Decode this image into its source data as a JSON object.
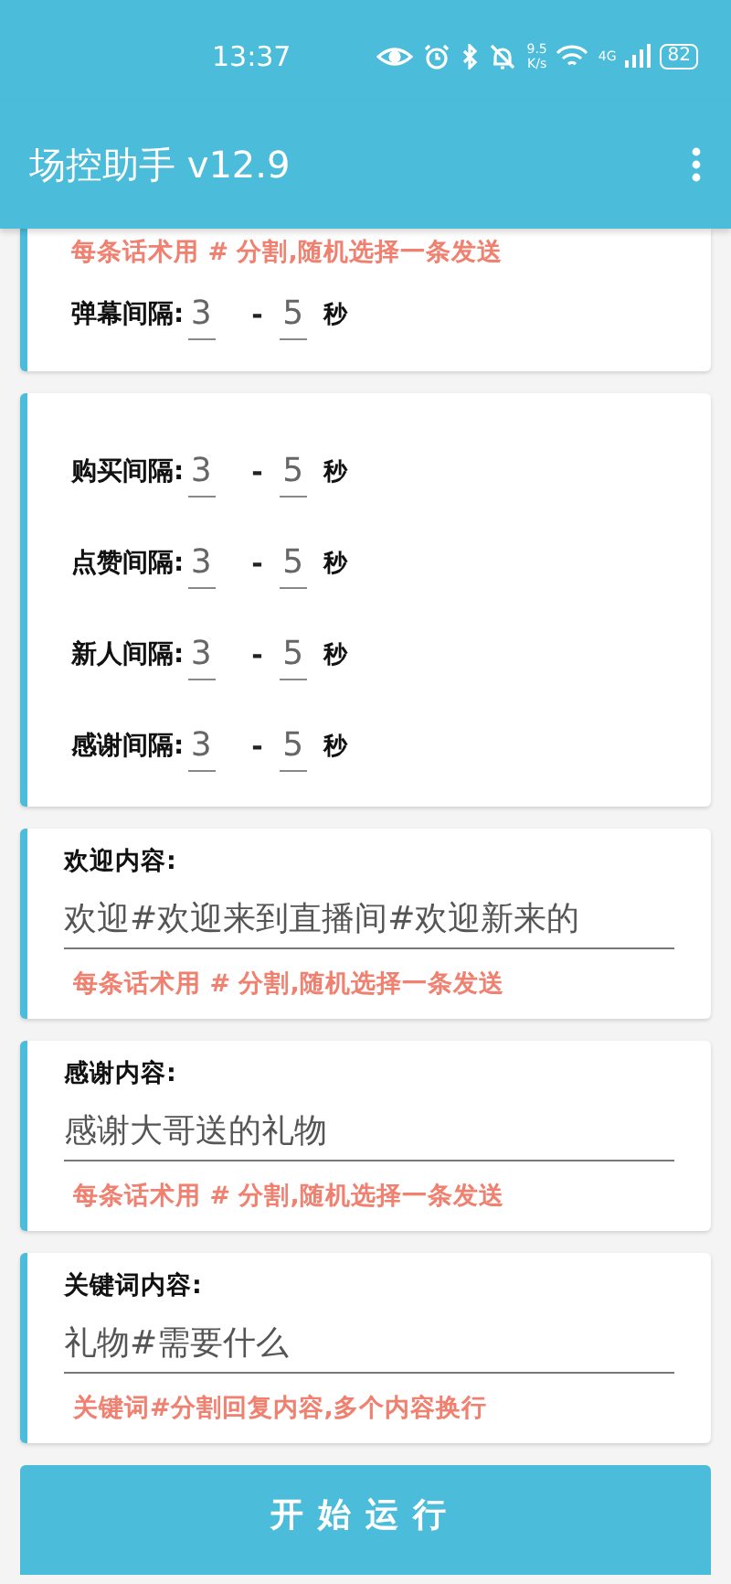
{
  "status_bar": {
    "time": "13:37",
    "net_speed": "9.5",
    "net_unit": "K/s",
    "network": "4G",
    "battery": "82"
  },
  "app_bar": {
    "title": "场控助手 v12.9"
  },
  "cards": [
    {
      "kind": "intervals",
      "hint_top": "每条话术用 # 分割,随机选择一条发送",
      "rows": [
        {
          "label": "弹幕间隔:",
          "min": "3",
          "separator": "-",
          "max": "5",
          "unit": "秒"
        }
      ]
    },
    {
      "kind": "intervals",
      "rows": [
        {
          "label": "购买间隔:",
          "min": "3",
          "separator": "-",
          "max": "5",
          "unit": "秒"
        },
        {
          "label": "点赞间隔:",
          "min": "3",
          "separator": "-",
          "max": "5",
          "unit": "秒"
        },
        {
          "label": "新人间隔:",
          "min": "3",
          "separator": "-",
          "max": "5",
          "unit": "秒"
        },
        {
          "label": "感谢间隔:",
          "min": "3",
          "separator": "-",
          "max": "5",
          "unit": "秒"
        }
      ]
    },
    {
      "kind": "text",
      "label": "欢迎内容:",
      "value": "欢迎#欢迎来到直播间#欢迎新来的",
      "hint": "每条话术用 # 分割,随机选择一条发送"
    },
    {
      "kind": "text",
      "label": "感谢内容:",
      "value": "感谢大哥送的礼物",
      "hint": "每条话术用 # 分割,随机选择一条发送"
    },
    {
      "kind": "text",
      "label": "关键词内容:",
      "value": "礼物#需要什么",
      "hint": "关键词#分割回复内容,多个内容换行"
    }
  ],
  "start_button": "开始运行"
}
